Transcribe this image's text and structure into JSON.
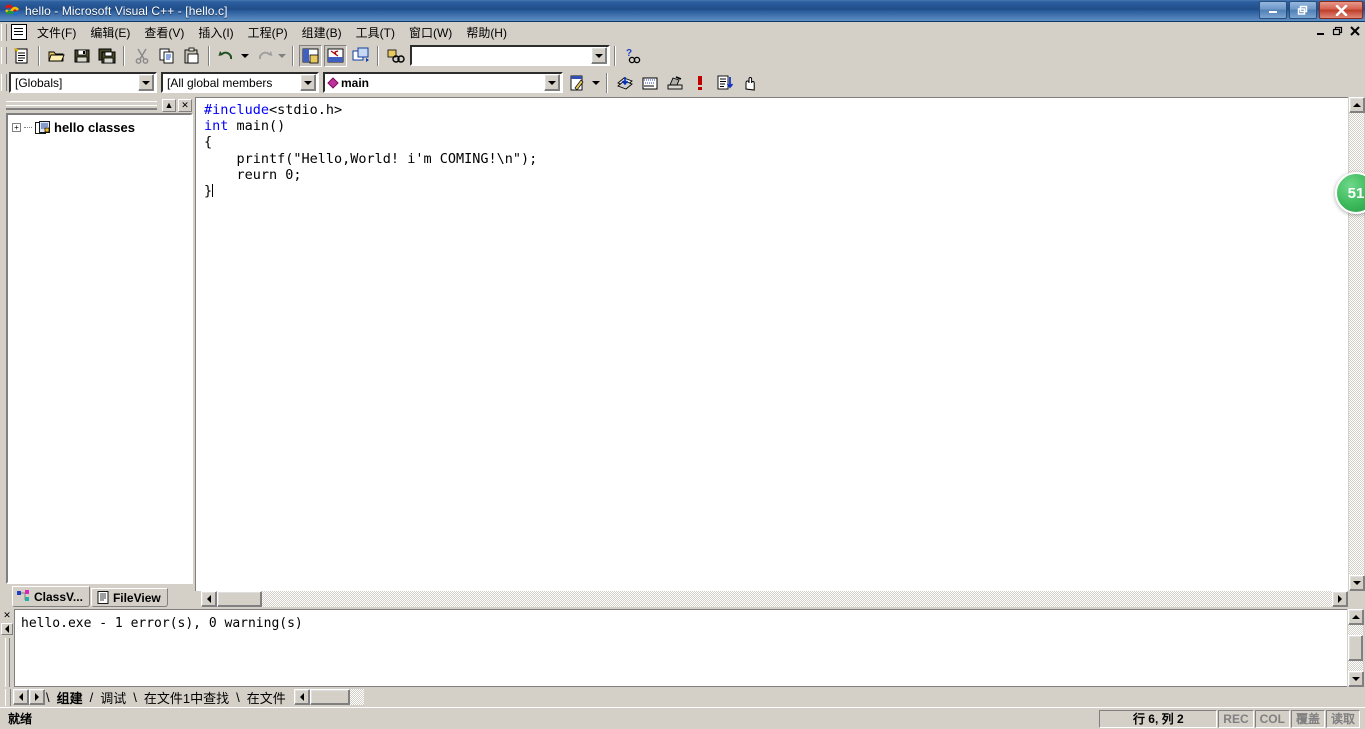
{
  "window": {
    "title": "hello - Microsoft Visual C++ - [hello.c]",
    "icon": "vcpp-logo-icon",
    "minimize_label": "–",
    "restore_label": "❐",
    "close_label": "✕"
  },
  "mdi": {
    "minimize_label": "_",
    "restore_label": "❐",
    "close_label": "✕"
  },
  "menu": {
    "items": [
      {
        "label": "文件(F)",
        "name": "menu-file"
      },
      {
        "label": "编辑(E)",
        "name": "menu-edit"
      },
      {
        "label": "查看(V)",
        "name": "menu-view"
      },
      {
        "label": "插入(I)",
        "name": "menu-insert"
      },
      {
        "label": "工程(P)",
        "name": "menu-project"
      },
      {
        "label": "组建(B)",
        "name": "menu-build"
      },
      {
        "label": "工具(T)",
        "name": "menu-tools"
      },
      {
        "label": "窗口(W)",
        "name": "menu-window"
      },
      {
        "label": "帮助(H)",
        "name": "menu-help"
      }
    ]
  },
  "toolbar_standard": {
    "buttons": [
      "new-text-file-icon",
      "open-folder-icon",
      "save-icon",
      "save-all-icon",
      "cut-icon",
      "copy-icon",
      "paste-icon",
      "undo-icon",
      "redo-icon",
      "workspace-window-icon",
      "output-window-icon",
      "window-list-icon",
      "find-in-files-icon"
    ],
    "find_value": "",
    "find_placeholder": "",
    "help_button": "context-help-icon"
  },
  "toolbar_wizardbar": {
    "class_combo": {
      "value": "[Globals]",
      "name": "class-combo"
    },
    "members_combo": {
      "value": "[All global members",
      "name": "members-combo"
    },
    "function_combo": {
      "value": "main",
      "icon": "member-diamond-icon",
      "name": "function-combo"
    },
    "action_button": "wizardbar-action-icon",
    "build_buttons": [
      "compile-icon",
      "build-icon",
      "rebuild-all-icon",
      "stop-build-icon",
      "execute-program-icon",
      "go-debug-icon"
    ]
  },
  "workspace": {
    "close_label": "✕",
    "collapse_label": "▲",
    "tree": {
      "expander": "+",
      "icon": "class-folder-icon",
      "label": "hello classes"
    },
    "tabs": [
      {
        "label": "ClassV...",
        "icon": "classview-icon",
        "active": true,
        "name": "tab-classview"
      },
      {
        "label": "FileView",
        "icon": "fileview-icon",
        "active": false,
        "name": "tab-fileview"
      }
    ]
  },
  "editor": {
    "filename": "hello.c",
    "lines": [
      [
        {
          "t": "#include",
          "k": true
        },
        {
          "t": "<stdio.h>",
          "k": false
        }
      ],
      [
        {
          "t": "int",
          "k": true
        },
        {
          "t": " main()",
          "k": false
        }
      ],
      [
        {
          "t": "{",
          "k": false
        }
      ],
      [
        {
          "t": "    printf(\"Hello,World! i'm COMING!\\n\");",
          "k": false
        }
      ],
      [
        {
          "t": "    reurn 0;",
          "k": false
        }
      ],
      [
        {
          "t": "}",
          "k": false
        }
      ]
    ]
  },
  "output": {
    "close_label": "✕",
    "text": "hello.exe - 1 error(s), 0 warning(s)",
    "tabs": [
      {
        "label": "组建",
        "active": true,
        "name": "output-tab-build"
      },
      {
        "label": "调试",
        "active": false,
        "name": "output-tab-debug"
      },
      {
        "label": "在文件1中查找",
        "active": false,
        "name": "output-tab-find1"
      },
      {
        "label": "在文件",
        "active": false,
        "name": "output-tab-find2"
      }
    ]
  },
  "statusbar": {
    "message": "就绪",
    "position": "行 6, 列 2",
    "cells": [
      {
        "label": "REC",
        "name": "status-rec"
      },
      {
        "label": "COL",
        "name": "status-col"
      },
      {
        "label": "覆盖",
        "name": "status-overwrite"
      },
      {
        "label": "读取",
        "name": "status-readonly"
      }
    ]
  },
  "badge": {
    "value": "51"
  },
  "colors": {
    "chrome": "#d4d0c8",
    "keyword": "#0000ff",
    "title_gradient_start": "#4b7cb5",
    "accent_green": "#3cb85a",
    "close_red": "#bd3c28"
  }
}
